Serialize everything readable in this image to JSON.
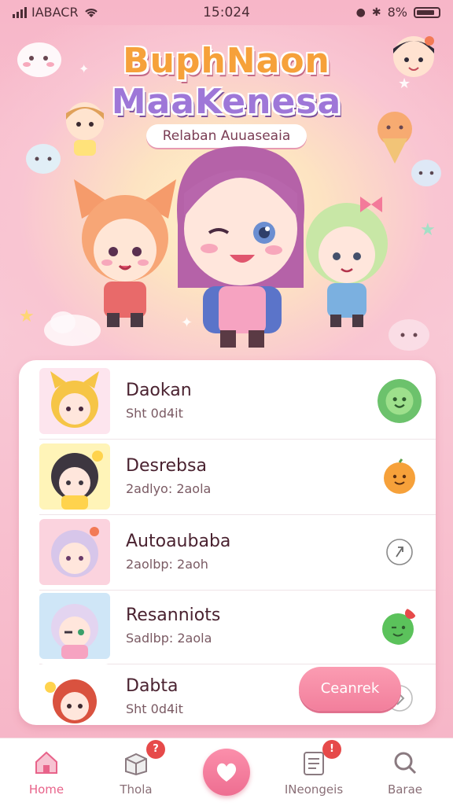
{
  "status_bar": {
    "carrier": "IABACR",
    "time": "15:024",
    "battery_percent": "8%",
    "battery_level": 0.85
  },
  "hero": {
    "title_line1": "BuphNaon",
    "title_line2": "MaaKenesa",
    "subtitle": "Relaban Auuaseaia"
  },
  "list": {
    "items": [
      {
        "name": "Daokan",
        "sub": "Sht 0d4it",
        "action_icon": "green-smile-face-icon"
      },
      {
        "name": "Desrebsa",
        "sub": "2adlyo: 2aola",
        "action_icon": "orange-smile-face-icon"
      },
      {
        "name": "Autoaubaba",
        "sub": "2aolbp: 2aoh",
        "action_icon": "share-arrow-icon"
      },
      {
        "name": "Resanniots",
        "sub": "Sadlbp: 2aola",
        "action_icon": "green-wink-face-icon"
      },
      {
        "name": "Dabta",
        "sub": "Sht 0d4it",
        "action_icon": "chevron-right-icon"
      }
    ],
    "cta_label": "Ceanrek"
  },
  "tabbar": {
    "tabs": [
      {
        "label": "Home",
        "icon": "home-icon",
        "active": true
      },
      {
        "label": "Thola",
        "icon": "box-icon",
        "badge": "?"
      },
      {
        "label": "",
        "icon": "heart-icon"
      },
      {
        "label": "INeongeis",
        "icon": "clipboard-icon",
        "badge": "!"
      },
      {
        "label": "Barae",
        "icon": "search-icon"
      }
    ]
  },
  "colors": {
    "accent": "#e8638a",
    "background": "#f7b6c8",
    "card": "#ffffff"
  }
}
